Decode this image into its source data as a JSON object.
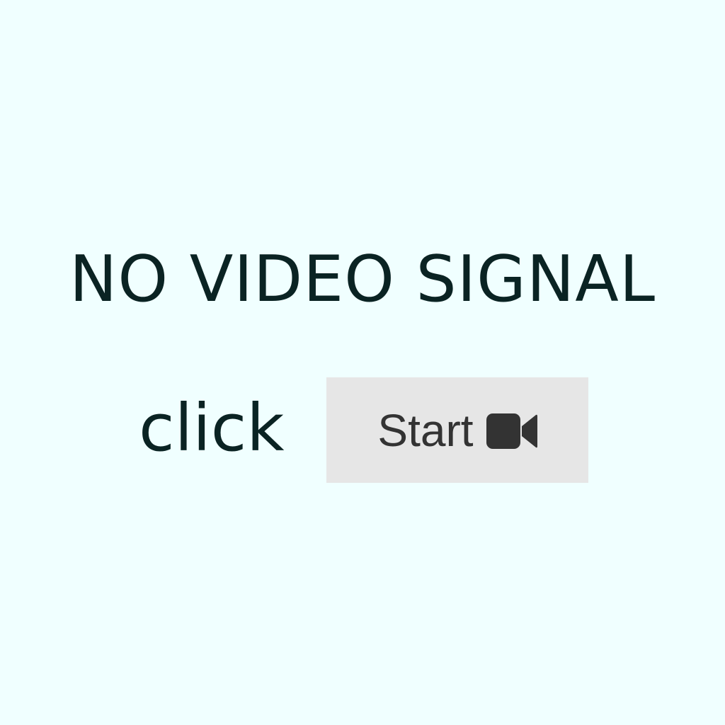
{
  "screen": {
    "message": "NO VIDEO SIGNAL",
    "prompt": "click"
  },
  "start_button": {
    "label": "Start",
    "icon": "video-camera-icon"
  },
  "colors": {
    "background": "#f0ffff",
    "text": "#0a2323",
    "button_bg": "#e6e6e6",
    "button_text": "#333333"
  }
}
